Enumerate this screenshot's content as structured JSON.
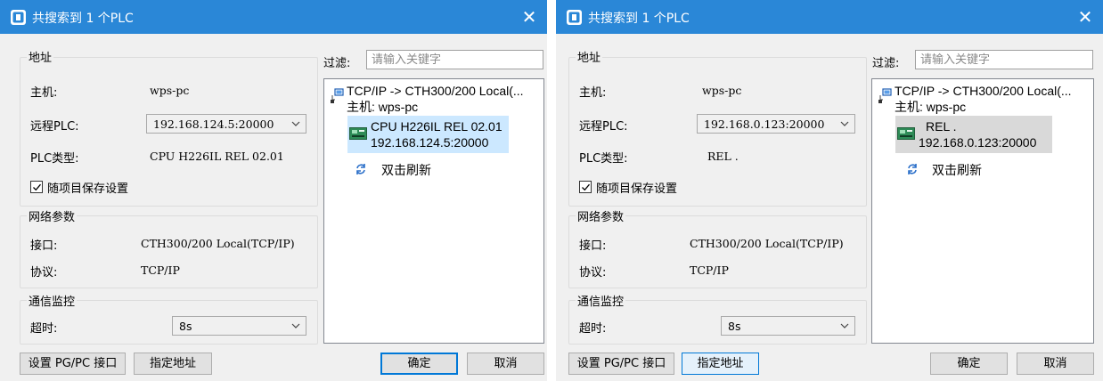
{
  "dialogs": [
    {
      "title": "共搜索到 1 个PLC",
      "close_glyph": "✕",
      "address_group": "地址",
      "host_label": "主机:",
      "host_value": "wps-pc",
      "remote_plc_label": "远程PLC:",
      "remote_plc_value": "192.168.124.5:20000",
      "plc_type_label": "PLC类型:",
      "plc_type_value": "CPU H226IL REL 02.01",
      "save_with_project_label": "随项目保存设置",
      "save_with_project_checked": true,
      "network_group": "网络参数",
      "interface_label": "接口:",
      "interface_value": "CTH300/200 Local(TCP/IP)",
      "protocol_label": "协议:",
      "protocol_value": "TCP/IP",
      "monitor_group": "通信监控",
      "timeout_label": "超时:",
      "timeout_value": "8s",
      "filter_label": "过滤:",
      "filter_placeholder": "请输入关键字",
      "tree": {
        "root_line1": "TCP/IP -> CTH300/200 Local(...",
        "root_line2": "主机: wps-pc",
        "device_line1": "CPU H226IL REL 02.01",
        "device_line2": "192.168.124.5:20000",
        "refresh_label": "双击刷新"
      },
      "buttons": {
        "set_pgpc": "设置 PG/PC 接口",
        "assign_address": "指定地址",
        "ok": "确定",
        "cancel": "取消"
      },
      "colors": {
        "selection": "#cce8ff"
      }
    },
    {
      "title": "共搜索到 1 个PLC",
      "close_glyph": "✕",
      "address_group": "地址",
      "host_label": "主机:",
      "host_value": "wps-pc",
      "remote_plc_label": "远程PLC:",
      "remote_plc_value": "192.168.0.123:20000",
      "plc_type_label": "PLC类型:",
      "plc_type_value": "REL .",
      "save_with_project_label": "随项目保存设置",
      "save_with_project_checked": true,
      "network_group": "网络参数",
      "interface_label": "接口:",
      "interface_value": "CTH300/200 Local(TCP/IP)",
      "protocol_label": "协议:",
      "protocol_value": "TCP/IP",
      "monitor_group": "通信监控",
      "timeout_label": "超时:",
      "timeout_value": "8s",
      "filter_label": "过滤:",
      "filter_placeholder": "请输入关键字",
      "tree": {
        "root_line1": "TCP/IP -> CTH300/200 Local(...",
        "root_line2": "主机: wps-pc",
        "device_line1": "REL .",
        "device_line2": "192.168.0.123:20000",
        "refresh_label": "双击刷新"
      },
      "buttons": {
        "set_pgpc": "设置 PG/PC 接口",
        "assign_address": "指定地址",
        "ok": "确定",
        "cancel": "取消"
      },
      "colors": {
        "selection": "#d9d9d9"
      }
    }
  ],
  "colors": {
    "titlebar": "#2a87d7",
    "dialog_bg": "#f0f0f0",
    "accent": "#0078d7"
  }
}
